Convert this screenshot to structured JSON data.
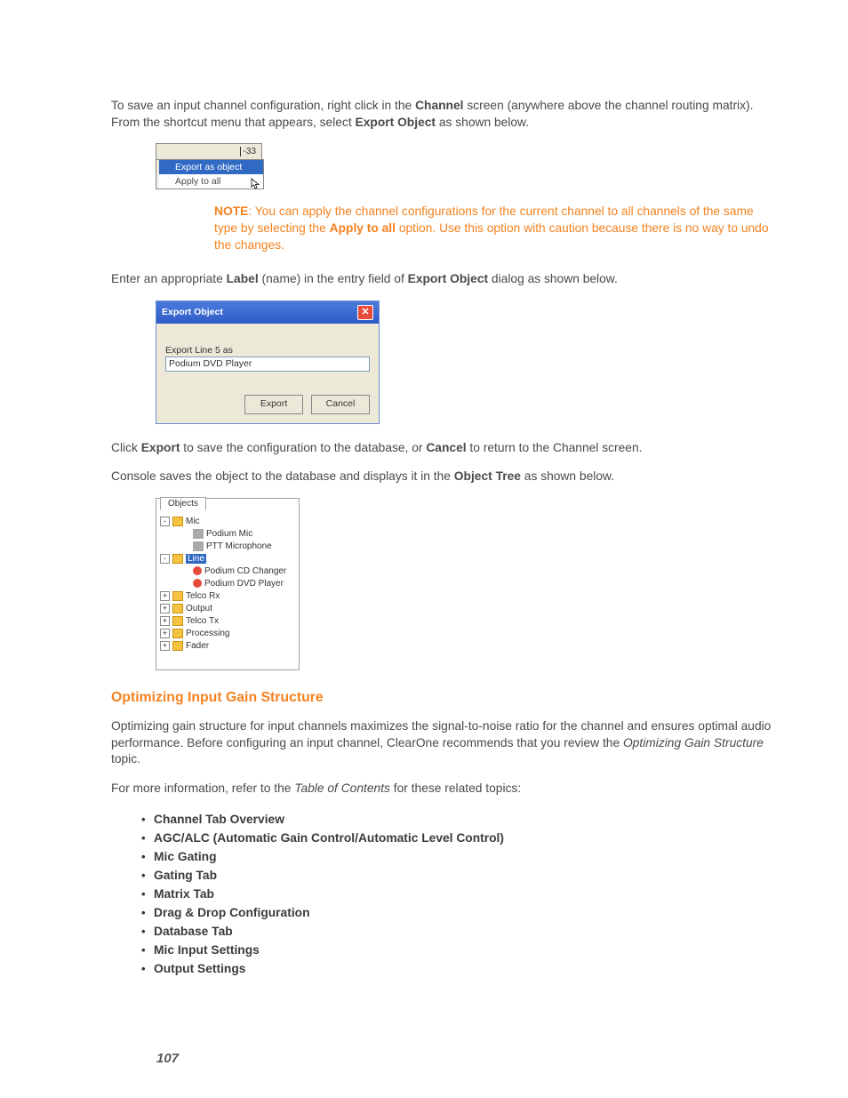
{
  "para1": {
    "t1": "To save an input channel configuration, right click in the ",
    "b1": "Channel",
    "t2": " screen (anywhere above the channel routing matrix). From the shortcut menu that appears, select ",
    "b2": "Export Object",
    "t3": " as shown below."
  },
  "context_menu": {
    "slider_value": "-33",
    "items": [
      "Export as object",
      "Apply to all"
    ],
    "selected_index": 0
  },
  "note": {
    "label": "NOTE",
    "t1": ": You can apply the channel configurations for the current channel to all channels of the same type by selecting the ",
    "b1": "Apply to all",
    "t2": " option. Use this option with caution because there is no way to undo the changes."
  },
  "para2": {
    "t1": "Enter an appropriate ",
    "b1": "Label",
    "t2": " (name) in the entry field of ",
    "b2": "Export Object",
    "t3": " dialog as shown below."
  },
  "dialog": {
    "title": "Export Object",
    "field_label": "Export Line 5 as",
    "field_value": "Podium DVD Player",
    "buttons": {
      "export": "Export",
      "cancel": "Cancel"
    }
  },
  "para3": {
    "t1": "Click ",
    "b1": "Export",
    "t2": " to save the configuration to the database, or ",
    "b2": "Cancel",
    "t3": " to return to the Channel screen."
  },
  "para4": {
    "t1": "Console saves the object to the database and displays it in the ",
    "b1": "Object Tree",
    "t2": " as shown below."
  },
  "tree": {
    "tab": "Objects",
    "nodes": [
      {
        "exp": "-",
        "depth": 0,
        "icon": "folder",
        "label": "Mic"
      },
      {
        "exp": "",
        "depth": 2,
        "icon": "mic",
        "label": "Podium Mic"
      },
      {
        "exp": "",
        "depth": 2,
        "icon": "mic",
        "label": "PTT Microphone"
      },
      {
        "exp": "-",
        "depth": 0,
        "icon": "folder",
        "label": "Line",
        "selected": true
      },
      {
        "exp": "",
        "depth": 2,
        "icon": "red",
        "label": "Podium CD Changer"
      },
      {
        "exp": "",
        "depth": 2,
        "icon": "red",
        "label": "Podium DVD Player"
      },
      {
        "exp": "+",
        "depth": 0,
        "icon": "folder",
        "label": "Telco Rx"
      },
      {
        "exp": "+",
        "depth": 0,
        "icon": "folder",
        "label": "Output"
      },
      {
        "exp": "+",
        "depth": 0,
        "icon": "folder",
        "label": "Telco Tx"
      },
      {
        "exp": "+",
        "depth": 0,
        "icon": "folder",
        "label": "Processing"
      },
      {
        "exp": "+",
        "depth": 0,
        "icon": "folder",
        "label": "Fader"
      }
    ]
  },
  "section_heading": "Optimizing Input Gain Structure",
  "para5": {
    "t1": "Optimizing gain structure for input channels maximizes the signal-to-noise ratio for the channel and ensures optimal audio performance. Before configuring an input channel, ClearOne recommends that you review the ",
    "i1": "Optimizing Gain Structure",
    "t2": " topic."
  },
  "para6": {
    "t1": "For more information, refer to the ",
    "i1": "Table of Contents",
    "t2": " for these related topics:"
  },
  "topics": [
    "Channel Tab Overview",
    "AGC/ALC (Automatic Gain Control/Automatic Level Control)",
    "Mic Gating",
    "Gating Tab",
    "Matrix Tab",
    "Drag & Drop Configuration",
    "Database Tab",
    "Mic Input Settings",
    "Output Settings"
  ],
  "page_number": "107"
}
